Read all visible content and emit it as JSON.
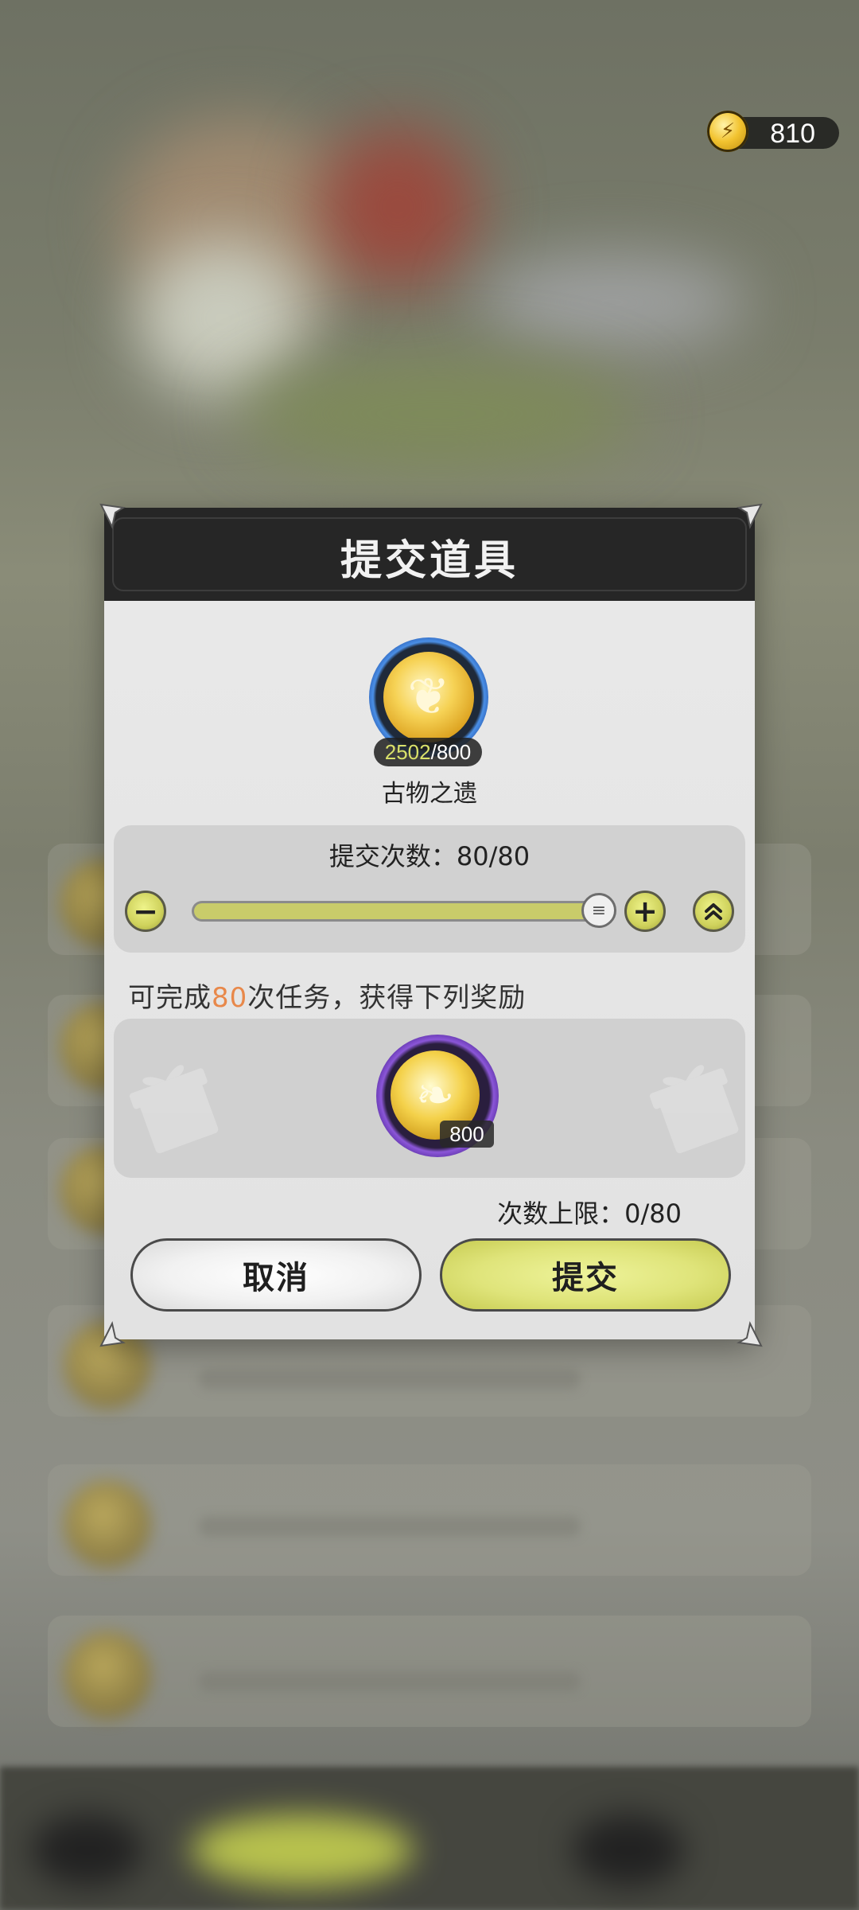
{
  "currency": {
    "icon": "energy-coin-icon",
    "amount": "810"
  },
  "dialog": {
    "title": "提交道具",
    "item": {
      "icon": "relic-coin-icon",
      "owned": "2502",
      "required": "/800",
      "name": "古物之遗"
    },
    "submit_count": {
      "label": "提交次数：80/80",
      "current": 80,
      "max": 80,
      "fill_fraction": 1.0
    },
    "reward": {
      "text_prefix": "可完成",
      "text_highlight": "80",
      "text_suffix": "次任务，获得下列奖励",
      "item_icon": "golden-leaf-icon",
      "quantity": "800"
    },
    "limit_label": "次数上限：0/80",
    "cancel_label": "取消",
    "submit_label": "提交"
  },
  "colors": {
    "accent": "#cfd25c",
    "highlight": "#e8884a",
    "header": "#262626"
  }
}
